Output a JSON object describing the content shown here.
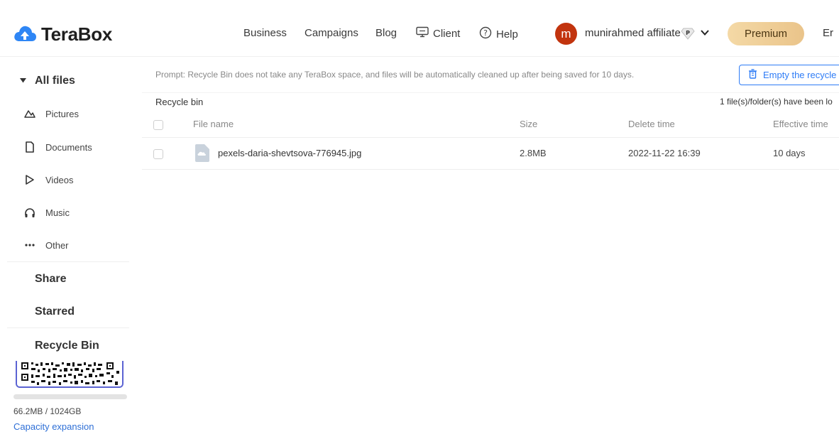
{
  "header": {
    "logo_text": "TeraBox",
    "nav": {
      "business": "Business",
      "campaigns": "Campaigns",
      "blog": "Blog",
      "client": "Client",
      "help": "Help"
    },
    "avatar_initial": "m",
    "username": "munirahmed affiliate",
    "premium_label": "Premium",
    "language_label": "Er"
  },
  "sidebar": {
    "all_files": "All files",
    "categories": {
      "pictures": "Pictures",
      "documents": "Documents",
      "videos": "Videos",
      "music": "Music",
      "other": "Other"
    },
    "share": "Share",
    "starred": "Starred",
    "recycle_bin": "Recycle Bin",
    "storage_used_fraction": 0.0001,
    "storage_text": "66.2MB / 1024GB",
    "capacity_link": "Capacity expansion"
  },
  "main": {
    "prompt": "Prompt: Recycle Bin does not take any TeraBox space, and files will be automatically cleaned up after being saved for 10 days.",
    "empty_button": "Empty the recycle",
    "title": "Recycle bin",
    "loaded_text": "1 file(s)/folder(s) have been lo",
    "columns": {
      "name": "File name",
      "size": "Size",
      "delete_time": "Delete time",
      "effective_time": "Effective time"
    },
    "rows": [
      {
        "name": "pexels-daria-shevtsova-776945.jpg",
        "size": "2.8MB",
        "delete_time": "2022-11-22 16:39",
        "effective_time": "10 days"
      }
    ]
  },
  "colors": {
    "accent": "#2e7cf6",
    "avatar": "#c2340e",
    "premium": "#eac48a"
  }
}
